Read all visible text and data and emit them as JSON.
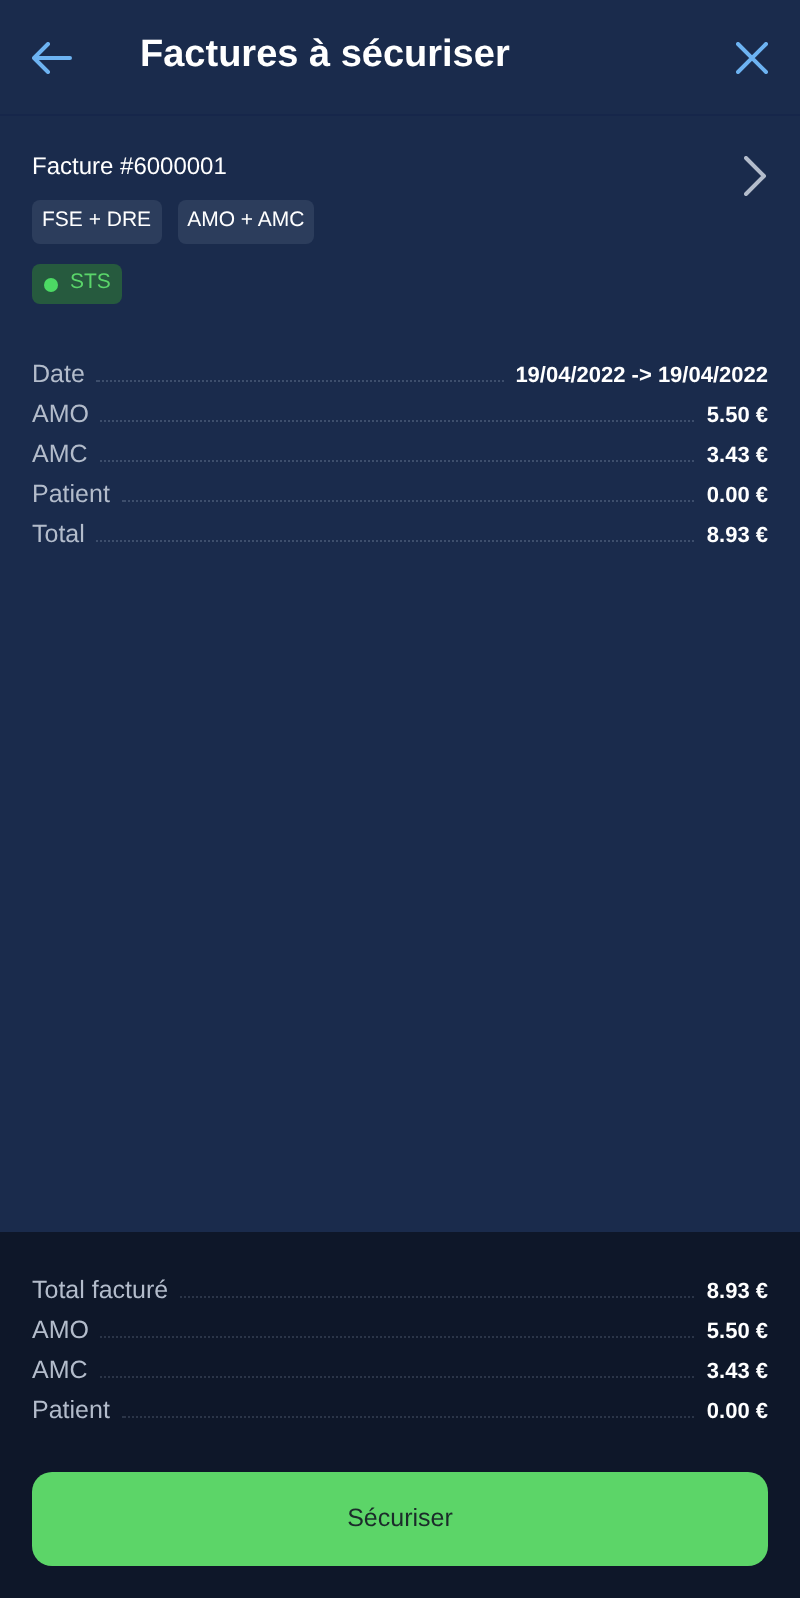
{
  "header": {
    "title": "Factures à sécuriser"
  },
  "invoice": {
    "title": "Facture #6000001",
    "tags": [
      "FSE + DRE",
      "AMO + AMC"
    ],
    "status": "STS",
    "details": [
      {
        "label": "Date",
        "value": "19/04/2022 -> 19/04/2022"
      },
      {
        "label": "AMO",
        "value": "5.50 €"
      },
      {
        "label": "AMC",
        "value": "3.43 €"
      },
      {
        "label": "Patient",
        "value": "0.00 €"
      },
      {
        "label": "Total",
        "value": "8.93 €"
      }
    ]
  },
  "summary": [
    {
      "label": "Total facturé",
      "value": "8.93 €"
    },
    {
      "label": "AMO",
      "value": "5.50 €"
    },
    {
      "label": "AMC",
      "value": "3.43 €"
    },
    {
      "label": "Patient",
      "value": "0.00 €"
    }
  ],
  "button": "Sécuriser"
}
